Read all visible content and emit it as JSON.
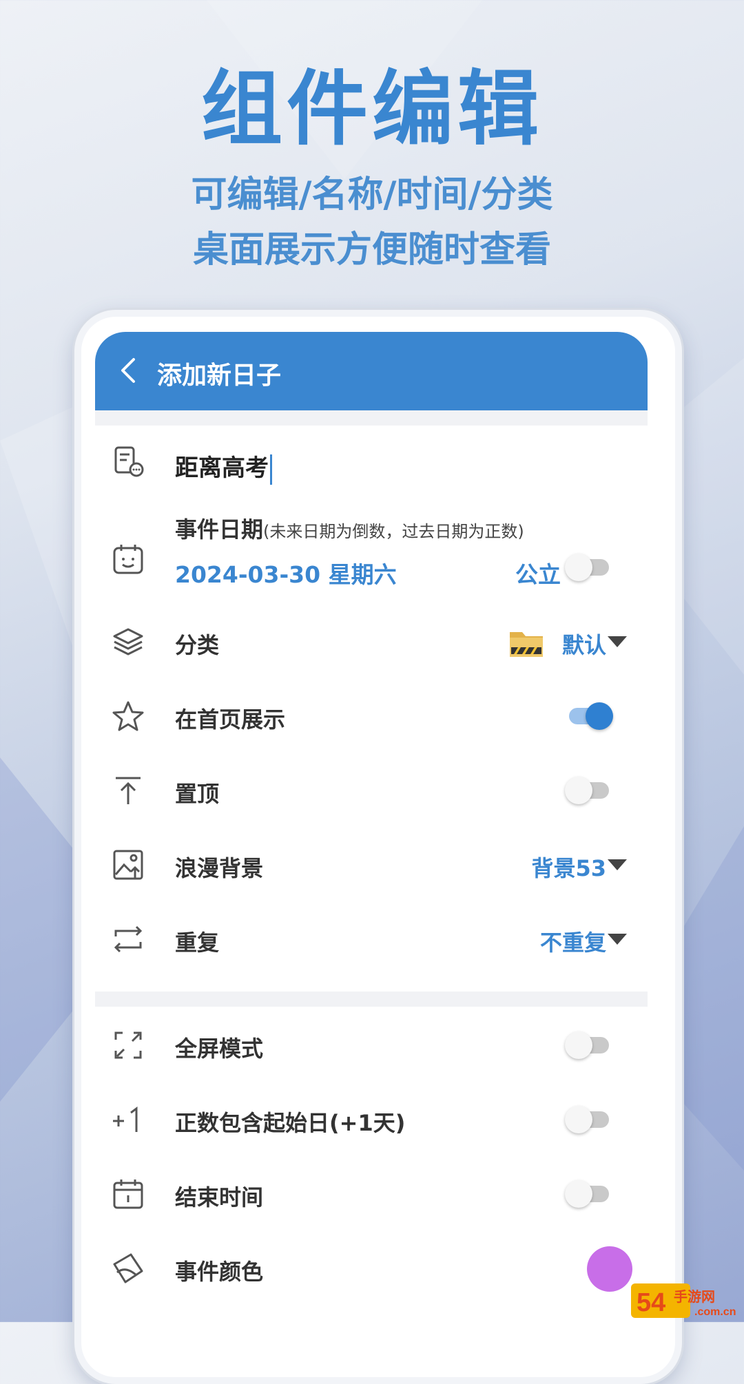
{
  "promo": {
    "title": "组件编辑",
    "subtitle_line1": "可编辑/名称/时间/分类",
    "subtitle_line2": "桌面展示方便随时查看"
  },
  "appbar": {
    "title": "添加新日子",
    "back_icon": "chevron-left-icon"
  },
  "form": {
    "event_name": "距离高考",
    "event_date": {
      "label": "事件日期",
      "hint": "(未来日期为倒数，过去日期为正数)",
      "value": "2024-03-30 星期六",
      "calendar_label": "公立",
      "lunar_enabled": false
    },
    "category": {
      "label": "分类",
      "value": "默认",
      "icon": "folder-icon"
    },
    "show_on_home": {
      "label": "在首页展示",
      "enabled": true
    },
    "pin_top": {
      "label": "置顶",
      "enabled": false
    },
    "background": {
      "label": "浪漫背景",
      "value": "背景53"
    },
    "repeat": {
      "label": "重复",
      "value": "不重复"
    },
    "fullscreen": {
      "label": "全屏模式",
      "enabled": false
    },
    "include_start": {
      "label": "正数包含起始日(+1天)",
      "enabled": false
    },
    "end_time": {
      "label": "结束时间",
      "enabled": false
    },
    "event_color": {
      "label": "事件颜色",
      "color": "#c86ee8"
    }
  },
  "colors": {
    "accent": "#3a86d0",
    "toggle_on": "#2f80d1"
  },
  "watermark": {
    "text_main": "54",
    "text_site": "手游网",
    "text_domain": ".com.cn"
  }
}
